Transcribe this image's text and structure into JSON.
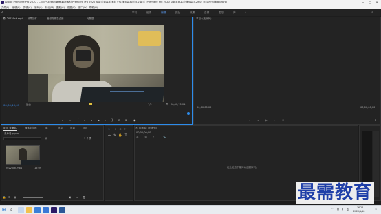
{
  "window": {
    "title": "Adobe Premiere Pro 2020 - C:\\用户\\xzkay\\桌面\\最新素材\\Premiere Pro 2020 从新手到高手-素材文件\\第6章\\素材\\5.2 新手 (Premiere Pro 2020 从新手到高手\\第6章\\5.2通过 软件进行\\编辑.prproj",
    "controls": [
      "—",
      "□",
      "✕"
    ]
  },
  "menu": [
    "文件(F)",
    "编辑(E)",
    "剪辑(C)",
    "序列(S)",
    "标记(M)",
    "图形(G)",
    "视图(V)",
    "窗口(W)",
    "帮助(H)"
  ],
  "workspaces": [
    "学习",
    "组件",
    "编辑",
    "颜色",
    "效果",
    "音频",
    "图形",
    "库"
  ],
  "active_workspace": "编辑",
  "source_monitor": {
    "tabs": [
      "源: 20220ck.mp4",
      "效果控件",
      "音频剪辑混合器",
      "元数据"
    ],
    "timecode_left": "00;00;13;07",
    "fit_label": "适合",
    "quality": "1/2",
    "timecode_right": "00;00;15;09"
  },
  "program_monitor": {
    "tab": "节目: (无序列)",
    "timecode_left": "00;00;00;00",
    "timecode_right": "00;00;00;00"
  },
  "project_panel": {
    "tabs": [
      "项目: 未命名",
      "媒体浏览器",
      "库",
      "信息",
      "效果",
      "标记"
    ],
    "project_name": "未命名.prproj",
    "item_count": "1 个项",
    "clip_name": "20220ck.mp4",
    "clip_duration": "15;09"
  },
  "timeline": {
    "tab": "时间轴: (无序列)",
    "timecode": "00;00;00;00",
    "empty_message": "在此处放下媒体以创建序列。"
  },
  "taskbar": {
    "time": "16:26",
    "date": "2022/1/18",
    "lang": "中"
  },
  "watermark": "最需教育",
  "colors": {
    "accent": "#2d8ceb",
    "timecode": "#3d8ef0",
    "panel": "#232323",
    "watermark": "#1f3fa8"
  }
}
